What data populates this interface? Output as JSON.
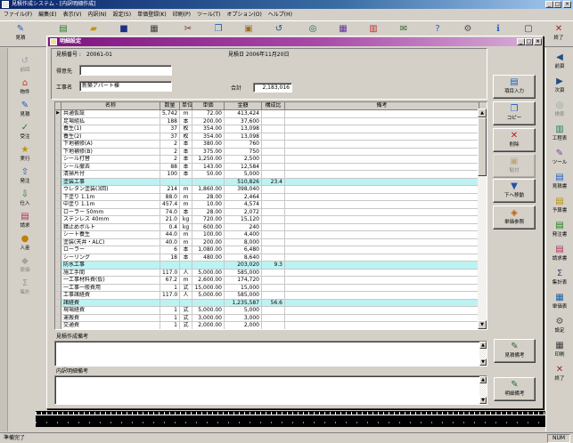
{
  "window": {
    "title": "見積作成システム - [内訳明細作成]"
  },
  "menu": [
    "ファイル(F)",
    "編集(E)",
    "表示(V)",
    "内訳(N)",
    "設定(S)",
    "単価登録(K)",
    "印刷(P)",
    "ツール(T)",
    "オプション(O)",
    "ヘルプ(H)"
  ],
  "toolbar": [
    {
      "label": "見積",
      "icon": "estimate-icon"
    },
    {
      "icon": "new-icon"
    },
    {
      "icon": "open-icon"
    },
    {
      "icon": "save-icon"
    },
    {
      "icon": "print-icon"
    },
    {
      "icon": "cut-icon"
    },
    {
      "icon": "copy-icon"
    },
    {
      "icon": "paste-icon"
    },
    {
      "icon": "undo-icon"
    },
    {
      "icon": "search-icon"
    },
    {
      "icon": "calc-icon"
    },
    {
      "icon": "chart-icon"
    },
    {
      "icon": "mail-icon"
    },
    {
      "icon": "help-icon"
    },
    {
      "icon": "settings-icon"
    },
    {
      "icon": "info-icon"
    },
    {
      "icon": "window-icon"
    },
    {
      "label": "終了",
      "icon": "exit-icon"
    }
  ],
  "left_sidebar": [
    {
      "label": "前回",
      "icon": "history-icon",
      "disabled": true
    },
    {
      "label": "物件",
      "icon": "property-icon"
    },
    {
      "label": "見積",
      "icon": "estimate-icon"
    },
    {
      "label": "受注",
      "icon": "order-icon"
    },
    {
      "label": "実行",
      "icon": "budget-icon"
    },
    {
      "label": "発注",
      "icon": "purchase-icon"
    },
    {
      "label": "仕入",
      "icon": "receipt-icon"
    },
    {
      "label": "請求",
      "icon": "invoice-icon"
    },
    {
      "label": "入金",
      "icon": "payment-icon"
    },
    {
      "label": "原価",
      "icon": "cost-icon",
      "disabled": true
    },
    {
      "label": "集計",
      "icon": "summary-icon",
      "disabled": true
    }
  ],
  "right_sidebar": [
    {
      "label": "前頁",
      "icon": "prev-page-icon"
    },
    {
      "label": "次頁",
      "icon": "next-page-icon"
    },
    {
      "label": "検索",
      "icon": "search-icon",
      "disabled": true
    },
    {
      "label": "工程表",
      "icon": "schedule-icon"
    },
    {
      "label": "ツール",
      "icon": "tool-icon"
    },
    {
      "label": "見積書",
      "icon": "estimate-doc-icon"
    },
    {
      "label": "予算書",
      "icon": "budget-doc-icon"
    },
    {
      "label": "発注書",
      "icon": "order-doc-icon"
    },
    {
      "label": "請求書",
      "icon": "invoice-doc-icon"
    },
    {
      "label": "集計表",
      "icon": "summary-doc-icon"
    },
    {
      "label": "単価表",
      "icon": "price-table-icon"
    },
    {
      "label": "設定",
      "icon": "settings-icon"
    },
    {
      "label": "印刷",
      "icon": "print-icon"
    },
    {
      "label": "終了",
      "icon": "exit-icon"
    }
  ],
  "dialog": {
    "title": "明細設定",
    "estimate_no_label": "見積番号 :",
    "estimate_no": "20061-01",
    "estimate_date": "見積日 2006年11月20日",
    "customer_label": "得意先",
    "customer_value": "",
    "project_label": "工事名",
    "project_value": "新築アパート棟",
    "total_label": "合計",
    "total_value": "2,183,016",
    "table": {
      "current_marker": "▶",
      "headers": [
        "名称",
        "数量",
        "単位",
        "単価",
        "金額",
        "構成比",
        "備考"
      ],
      "rows": [
        {
          "name": "共通仮設",
          "qty": "5,742",
          "unit": "m",
          "price": "72.00",
          "amount": "413,424",
          "ratio": "",
          "note": ""
        },
        {
          "name": "足場組払",
          "qty": "188",
          "unit": "本",
          "price": "200.00",
          "amount": "37,600",
          "ratio": "",
          "note": ""
        },
        {
          "name": "養生(1)",
          "qty": "37",
          "unit": "枚",
          "price": "354.00",
          "amount": "13,098",
          "ratio": "",
          "note": ""
        },
        {
          "name": "養生(2)",
          "qty": "37",
          "unit": "枚",
          "price": "354.00",
          "amount": "13,098",
          "ratio": "",
          "note": ""
        },
        {
          "name": "下地補修(A)",
          "qty": "2",
          "unit": "本",
          "price": "380.00",
          "amount": "760",
          "ratio": "",
          "note": ""
        },
        {
          "name": "下地補修(B)",
          "qty": "2",
          "unit": "本",
          "price": "375.00",
          "amount": "750",
          "ratio": "",
          "note": ""
        },
        {
          "name": "シール打替",
          "qty": "2",
          "unit": "本",
          "price": "1,250.00",
          "amount": "2,500",
          "ratio": "",
          "note": ""
        },
        {
          "name": "シール撤去",
          "qty": "88",
          "unit": "本",
          "price": "143.00",
          "amount": "12,584",
          "ratio": "",
          "note": ""
        },
        {
          "name": "清掃片付",
          "qty": "100",
          "unit": "本",
          "price": "50.00",
          "amount": "5,000",
          "ratio": "",
          "note": ""
        },
        {
          "name": "塗装工事",
          "qty": "",
          "unit": "",
          "price": "",
          "amount": "510,826",
          "ratio": "23.4",
          "note": "",
          "group": true
        },
        {
          "name": "ウレタン塗装(3回)",
          "qty": "214",
          "unit": "m",
          "price": "1,860.00",
          "amount": "398,040",
          "ratio": "",
          "note": ""
        },
        {
          "name": "下塗り 1.1m",
          "qty": "88.0",
          "unit": "m",
          "price": "28.00",
          "amount": "2,464",
          "ratio": "",
          "note": ""
        },
        {
          "name": "中塗り 1.1m",
          "qty": "457.4",
          "unit": "m",
          "price": "10.00",
          "amount": "4,574",
          "ratio": "",
          "note": ""
        },
        {
          "name": "ローラー 50mm",
          "qty": "74.0",
          "unit": "本",
          "price": "28.00",
          "amount": "2,072",
          "ratio": "",
          "note": ""
        },
        {
          "name": "ステンレス 40mm",
          "qty": "21.0",
          "unit": "kg",
          "price": "720.00",
          "amount": "15,120",
          "ratio": "",
          "note": ""
        },
        {
          "name": "錆止めボルト",
          "qty": "0.4",
          "unit": "kg",
          "price": "600.00",
          "amount": "240",
          "ratio": "",
          "note": ""
        },
        {
          "name": "シート養生",
          "qty": "44.0",
          "unit": "m",
          "price": "100.00",
          "amount": "4,400",
          "ratio": "",
          "note": ""
        },
        {
          "name": "塗装(天井・ALC)",
          "qty": "40.0",
          "unit": "m",
          "price": "200.00",
          "amount": "8,000",
          "ratio": "",
          "note": ""
        },
        {
          "name": "ローラー",
          "qty": "6",
          "unit": "本",
          "price": "1,080.00",
          "amount": "6,480",
          "ratio": "",
          "note": ""
        },
        {
          "name": "シーリング",
          "qty": "18",
          "unit": "本",
          "price": "480.00",
          "amount": "8,640",
          "ratio": "",
          "note": ""
        },
        {
          "name": "防水工事",
          "qty": "",
          "unit": "",
          "price": "",
          "amount": "203,020",
          "ratio": "9.3",
          "note": "",
          "group": true
        },
        {
          "name": "施工手間",
          "qty": "117.0",
          "unit": "人",
          "price": "5,000.00",
          "amount": "585,000",
          "ratio": "",
          "note": ""
        },
        {
          "name": "一工事材料費(仮)",
          "qty": "67.2",
          "unit": "m",
          "price": "2,600.00",
          "amount": "174,720",
          "ratio": "",
          "note": ""
        },
        {
          "name": "一工事一般費用",
          "qty": "1",
          "unit": "式",
          "price": "15,000.00",
          "amount": "15,000",
          "ratio": "",
          "note": ""
        },
        {
          "name": "工事諸経費",
          "qty": "117.0",
          "unit": "人",
          "price": "5,000.00",
          "amount": "585,000",
          "ratio": "",
          "note": ""
        },
        {
          "name": "諸経費",
          "qty": "",
          "unit": "",
          "price": "",
          "amount": "1,235,587",
          "ratio": "56.6",
          "note": "",
          "group": true
        },
        {
          "name": "現場経費",
          "qty": "1",
          "unit": "式",
          "price": "5,000.00",
          "amount": "5,000",
          "ratio": "",
          "note": ""
        },
        {
          "name": "運搬費",
          "qty": "1",
          "unit": "式",
          "price": "3,000.00",
          "amount": "3,000",
          "ratio": "",
          "note": ""
        },
        {
          "name": "交通費",
          "qty": "1",
          "unit": "式",
          "price": "2,000.00",
          "amount": "2,000",
          "ratio": "",
          "note": ""
        }
      ]
    },
    "side_buttons": [
      {
        "label": "項目入力",
        "icon": "insert-row-icon"
      },
      {
        "label": "コピー",
        "icon": "copy-icon"
      },
      {
        "label": "削除",
        "icon": "delete-icon"
      },
      {
        "label": "貼付",
        "icon": "paste-icon",
        "disabled": true
      },
      {
        "label": "下へ移動",
        "icon": "move-down-icon"
      },
      {
        "label": "単価参照",
        "icon": "price-lookup-icon"
      }
    ],
    "estimate_note": {
      "label": "見積作成備考",
      "value": "",
      "button": "見積備考",
      "icon": "note-icon"
    },
    "detail_note": {
      "label": "内訳明細備考",
      "value": "",
      "button": "明細備考",
      "icon": "note-icon"
    }
  },
  "status": {
    "text": "準備完了",
    "indicator": "NUM"
  }
}
